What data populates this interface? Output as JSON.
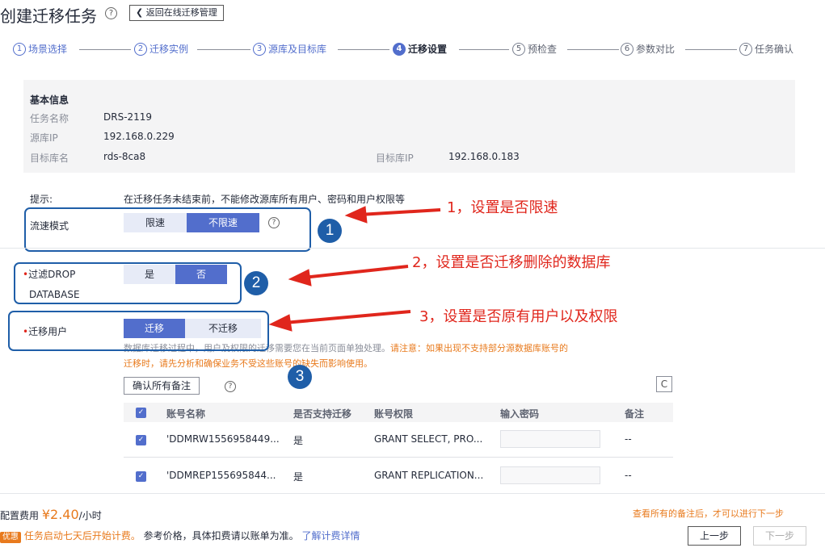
{
  "header": {
    "title": "创建迁移任务",
    "help": "?",
    "back_label": "返回在线迁移管理"
  },
  "steps": [
    {
      "num": "1",
      "label": "场景选择"
    },
    {
      "num": "2",
      "label": "迁移实例"
    },
    {
      "num": "3",
      "label": "源库及目标库"
    },
    {
      "num": "4",
      "label": "迁移设置"
    },
    {
      "num": "5",
      "label": "预检查"
    },
    {
      "num": "6",
      "label": "参数对比"
    },
    {
      "num": "7",
      "label": "任务确认"
    }
  ],
  "info": {
    "section_title": "基本信息",
    "task_name_label": "任务名称",
    "task_name": "DRS-2119",
    "source_ip_label": "源库IP",
    "source_ip": "192.168.0.229",
    "target_name_label": "目标库名",
    "target_name": "rds-8ca8",
    "target_ip_label": "目标库IP",
    "target_ip": "192.168.0.183"
  },
  "tip": {
    "label": "提示:",
    "text": "在迁移任务未结束前，不能修改源库所有用户、密码和用户权限等"
  },
  "speed": {
    "label": "流速模式",
    "options": [
      "限速",
      "不限速"
    ],
    "selected": "不限速"
  },
  "filter_drop": {
    "label_line1": "过滤DROP",
    "label_line2": "DATABASE",
    "options": [
      "是",
      "否"
    ],
    "selected": "否"
  },
  "migrate_users": {
    "label": "迁移用户",
    "options": [
      "迁移",
      "不迁移"
    ],
    "selected": "迁移",
    "note_grey": "数据库迁移过程中，用户及权限的迁移需要您在当前页面单独处理。",
    "note_orange_1": "请注意：如果出现不支持部分源数据库账号的",
    "note_orange_2": "迁移时，请先分析和确保业务不受这些账号的缺失而影响使用。"
  },
  "annotations": {
    "num1": "1",
    "num2": "2",
    "num3": "3",
    "text1": "1，设置是否限速",
    "text2": "2，设置是否迁移删除的数据库",
    "text3": "3，设置是否原有用户以及权限"
  },
  "table": {
    "confirm_label": "确认所有备注",
    "refresh_icon": "C",
    "headers": [
      "账号名称",
      "是否支持迁移",
      "账号权限",
      "输入密码",
      "备注"
    ],
    "rows": [
      {
        "name": "'DDMRW1556958449...",
        "supported": "是",
        "privilege": "GRANT SELECT, PRO...",
        "remark": "--"
      },
      {
        "name": "'DDMREP155695844...",
        "supported": "是",
        "privilege": "GRANT REPLICATION...",
        "remark": "--"
      }
    ]
  },
  "footer": {
    "fee_label": "配置费用",
    "price": "¥2.40",
    "unit": "/小时",
    "badge": "优惠",
    "promo": "任务启动七天后开始计费。",
    "ref_note": "参考价格，具体扣费请以账单为准。",
    "detail_link": "了解计费详情",
    "hint": "查看所有的备注后，才可以进行下一步",
    "prev_label": "上一步",
    "next_label": "下一步"
  }
}
